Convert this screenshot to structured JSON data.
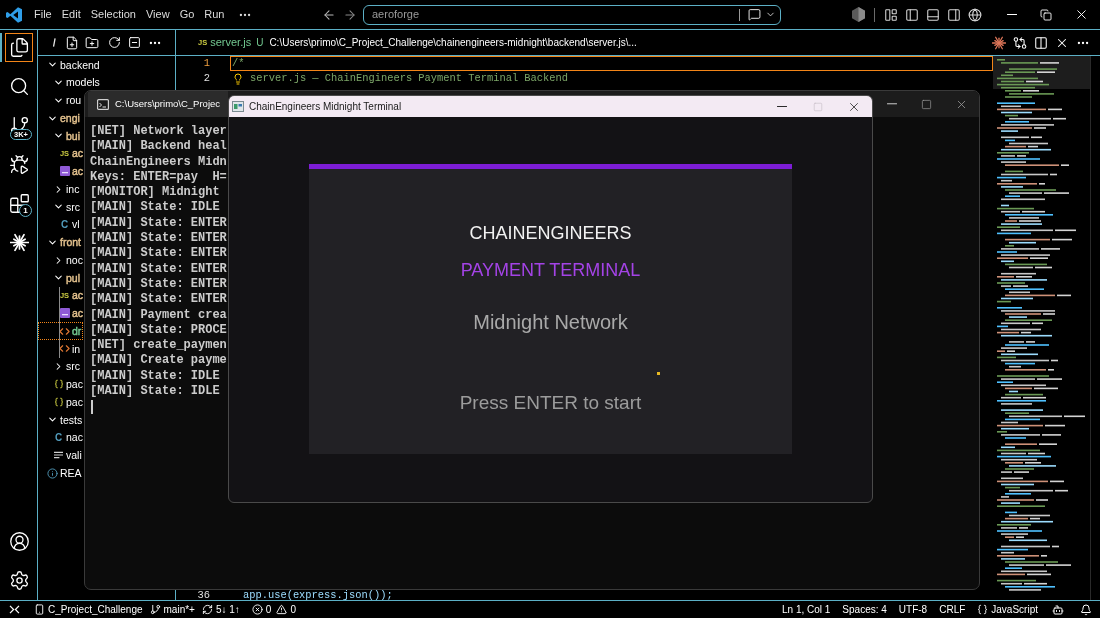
{
  "title_bar": {
    "menus": [
      "File",
      "Edit",
      "Selection",
      "View",
      "Go",
      "Run"
    ],
    "command_center": {
      "label": "aeroforge"
    }
  },
  "activity_bar": {
    "items": [
      {
        "kind": "explorer",
        "selected": true
      },
      {
        "kind": "search",
        "selected": false
      },
      {
        "kind": "source-control",
        "selected": false,
        "badge": "3K+"
      },
      {
        "kind": "run-debug",
        "selected": false
      },
      {
        "kind": "extensions",
        "selected": false,
        "badge": "1"
      },
      {
        "kind": "sparkle",
        "selected": false
      }
    ],
    "bottom": [
      {
        "kind": "account"
      },
      {
        "kind": "settings"
      }
    ]
  },
  "explorer": {
    "tree": [
      {
        "name": "backend",
        "kind": "folder",
        "expanded": true,
        "selected": false,
        "children": [
          {
            "name": "models",
            "kind": "folder",
            "expanded": true,
            "selected": false
          },
          {
            "name": "rou",
            "kind": "folder",
            "expanded": true,
            "selected": false
          }
        ]
      },
      {
        "name": "engi",
        "kind": "folder",
        "expanded": true,
        "selected": false,
        "color": "#e2c08d",
        "children": [
          {
            "name": "bui",
            "kind": "folder",
            "expanded": true,
            "selected": false,
            "color": "#e2c08d",
            "children": [
              {
                "name": "ac",
                "kind": "js",
                "glyph": "JS",
                "selected": false,
                "color": "#e2c08d"
              },
              {
                "name": "ac",
                "kind": "tile",
                "selected": false,
                "color": "#e2c08d"
              }
            ]
          },
          {
            "name": "inc",
            "kind": "folder",
            "expanded": false,
            "selected": false
          },
          {
            "name": "src",
            "kind": "folder",
            "expanded": true,
            "selected": false,
            "children": [
              {
                "name": "vl",
                "kind": "c",
                "glyph": "C",
                "selected": false
              }
            ]
          }
        ]
      },
      {
        "name": "front",
        "kind": "folder",
        "expanded": true,
        "selected": false,
        "color": "#e2c08d",
        "children": [
          {
            "name": "noc",
            "kind": "folder",
            "expanded": false,
            "selected": false
          },
          {
            "name": "pul",
            "kind": "folder",
            "expanded": true,
            "selected": false,
            "color": "#e2c08d",
            "children": [
              {
                "name": "ac",
                "kind": "js",
                "glyph": "JS",
                "selected": false,
                "color": "#e2c08d"
              },
              {
                "name": "ac",
                "kind": "tile",
                "selected": false,
                "color": "#e2c08d"
              },
              {
                "name": "dr",
                "kind": "html",
                "selected": true,
                "color": "#73c991"
              },
              {
                "name": "in",
                "kind": "html",
                "selected": false
              }
            ]
          },
          {
            "name": "src",
            "kind": "folder",
            "expanded": false,
            "selected": false
          },
          {
            "name": "pac",
            "kind": "json",
            "selected": false
          },
          {
            "name": "pac",
            "kind": "json",
            "selected": false
          }
        ]
      },
      {
        "name": "tests",
        "kind": "folder",
        "expanded": true,
        "selected": false,
        "children": [
          {
            "name": "nac",
            "kind": "c",
            "glyph": "C",
            "selected": false
          },
          {
            "name": "vali",
            "kind": "text",
            "selected": false
          }
        ]
      },
      {
        "name": "REA",
        "kind": "info",
        "selected": false
      }
    ]
  },
  "editor": {
    "tab": {
      "glyph": "JS",
      "name": "server.js",
      "status": "U",
      "path": "C:\\Users\\primo\\C_Project_Challenge\\chainengineers-midnight\\backend\\server.js\\..."
    },
    "lines": [
      {
        "number": "1",
        "text": "/*",
        "active": true,
        "lightbulb": false
      },
      {
        "number": "2",
        "text": "server.js — ChainEngineers Payment Terminal Backend",
        "active": false,
        "lightbulb": true
      },
      {
        "number": "36",
        "text": "app.use(express.json());",
        "active": false,
        "lightbulb": false
      }
    ]
  },
  "terminal_window": {
    "tab_title": "C:\\Users\\primo\\C_Projec",
    "lines": [
      "[NET] Network layer",
      "[MAIN] Backend heal",
      "ChainEngineers Midn",
      "Keys: ENTER=pay  H=",
      "[MONITOR] Midnight",
      "[MAIN] State: IDLE",
      "[MAIN] State: ENTER",
      "[MAIN] State: ENTER",
      "[MAIN] State: ENTER",
      "[MAIN] State: ENTER",
      "[MAIN] State: ENTER",
      "[MAIN] State: ENTER",
      "[MAIN] Payment crea",
      "[MAIN] State: PROCE",
      "[NET] create_paymen",
      "[MAIN] Create payme",
      "[MAIN] State: IDLE",
      "[MAIN] State: IDLE"
    ]
  },
  "game_window": {
    "title": "ChainEngineers Midnight Terminal",
    "controls": [
      {
        "kind": "minimize",
        "disabled": false
      },
      {
        "kind": "maximize",
        "disabled": true
      },
      {
        "kind": "close",
        "disabled": false
      }
    ],
    "heading": "CHAINENGINEERS",
    "subheading": "PAYMENT TERMINAL",
    "network": "Midnight Network",
    "prompt": "Press ENTER to start"
  },
  "status_bar": {
    "left": [
      {
        "kind": "remote"
      },
      {
        "kind": "workspace",
        "text": "C_Project_Challenge"
      },
      {
        "kind": "branch",
        "text": "main*+"
      },
      {
        "kind": "sync",
        "text": "5↓ 1↑"
      },
      {
        "kind": "problems",
        "errors": "0",
        "warnings": "0"
      }
    ],
    "right": [
      {
        "kind": "plain",
        "text": "Ln 1, Col 1"
      },
      {
        "kind": "plain",
        "text": "Spaces: 4"
      },
      {
        "kind": "plain",
        "text": "UTF-8"
      },
      {
        "kind": "plain",
        "text": "CRLF"
      },
      {
        "kind": "language",
        "text": "JavaScript"
      },
      {
        "kind": "copilot"
      },
      {
        "kind": "notifications"
      }
    ]
  }
}
